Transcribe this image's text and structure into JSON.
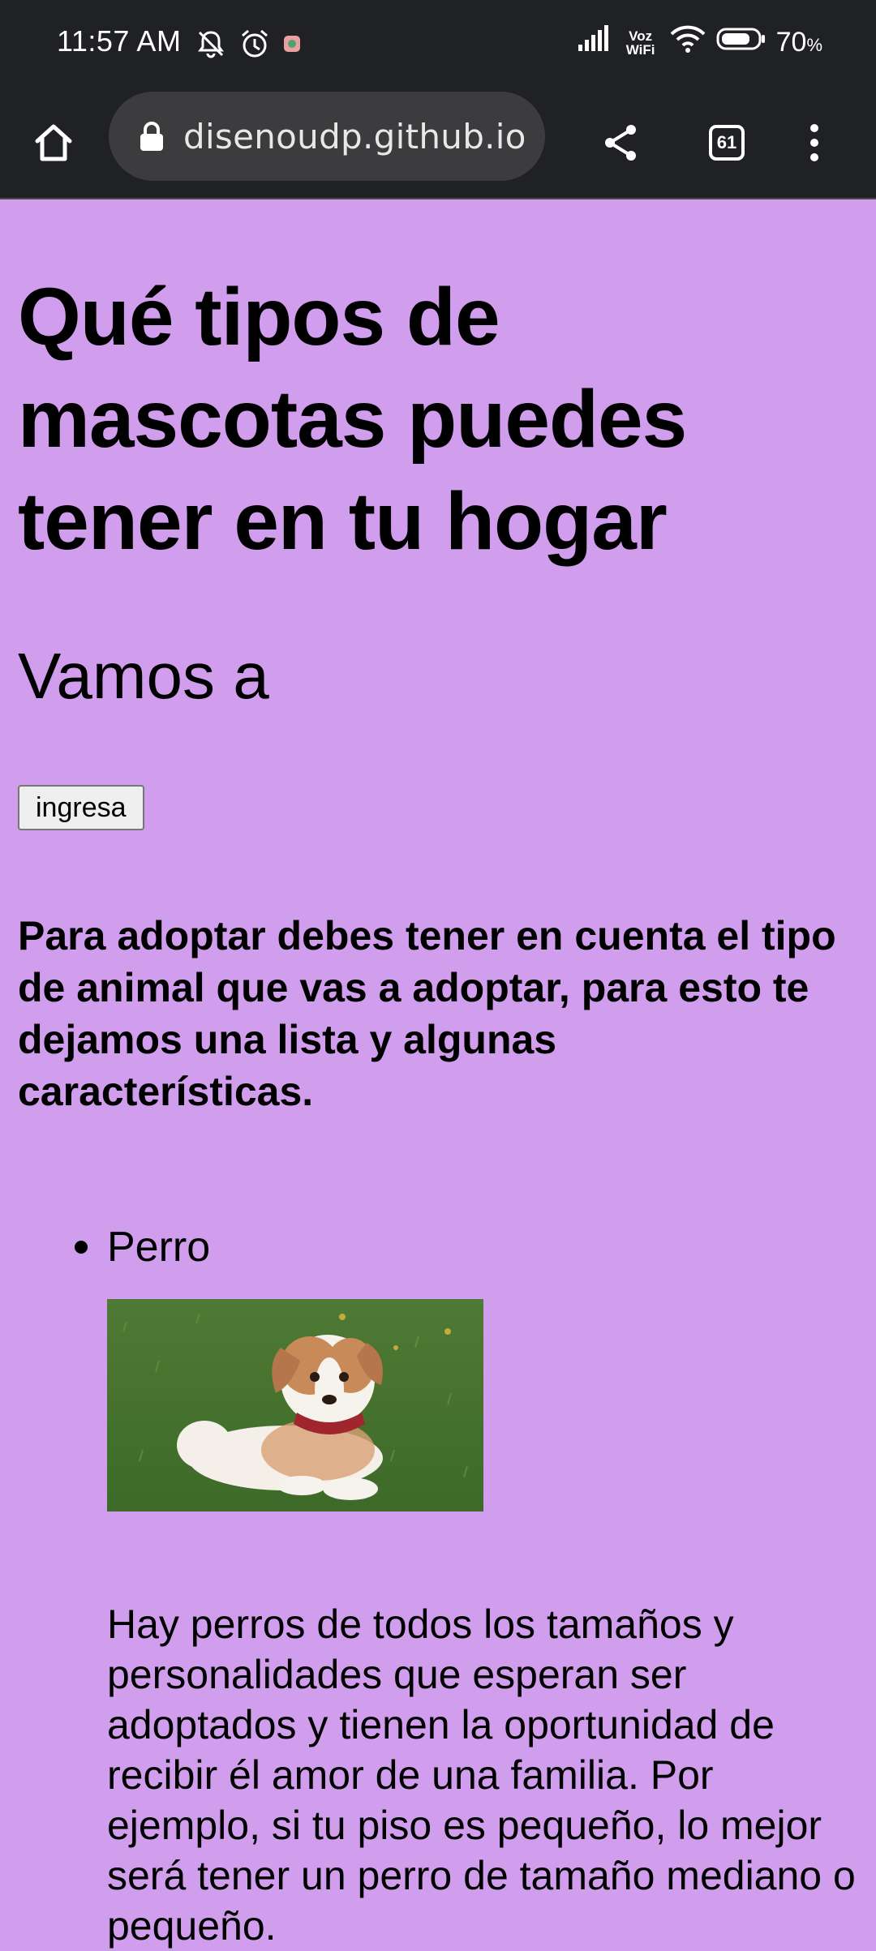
{
  "status_bar": {
    "time": "11:57 AM",
    "voz_label_top": "Voz",
    "voz_label_bottom": "WiFi",
    "battery_percent": "70",
    "battery_unit": "%",
    "icons": [
      "mute-icon",
      "alarm-icon",
      "app-notification-icon",
      "signal-icon",
      "wifi-icon",
      "battery-icon"
    ]
  },
  "browser": {
    "url": "disenoudp.github.io/c",
    "tab_count": "61",
    "icons": [
      "home-icon",
      "lock-icon",
      "share-icon",
      "tabs-icon",
      "more-vert-icon"
    ]
  },
  "page": {
    "title": "Qué tipos de mascotas puedes tener en tu hogar",
    "subtitle": "Vamos a",
    "button_label": "ingresa",
    "intro": "Para adoptar debes tener en cuenta el tipo de animal que vas a adoptar, para esto te dejamos una lista y algunas características.",
    "pets": [
      {
        "name": "Perro",
        "description": "Hay perros de todos los tamaños y personalidades que esperan ser adoptados y tienen la oportunidad de recibir él amor de una familia. Por ejemplo, si tu piso es pequeño, lo mejor será tener un perro de tamaño mediano o pequeño."
      }
    ]
  },
  "colors": {
    "page_background": "#d19ded",
    "browser_chrome": "#202124",
    "omnibox": "#3c3c3e"
  }
}
